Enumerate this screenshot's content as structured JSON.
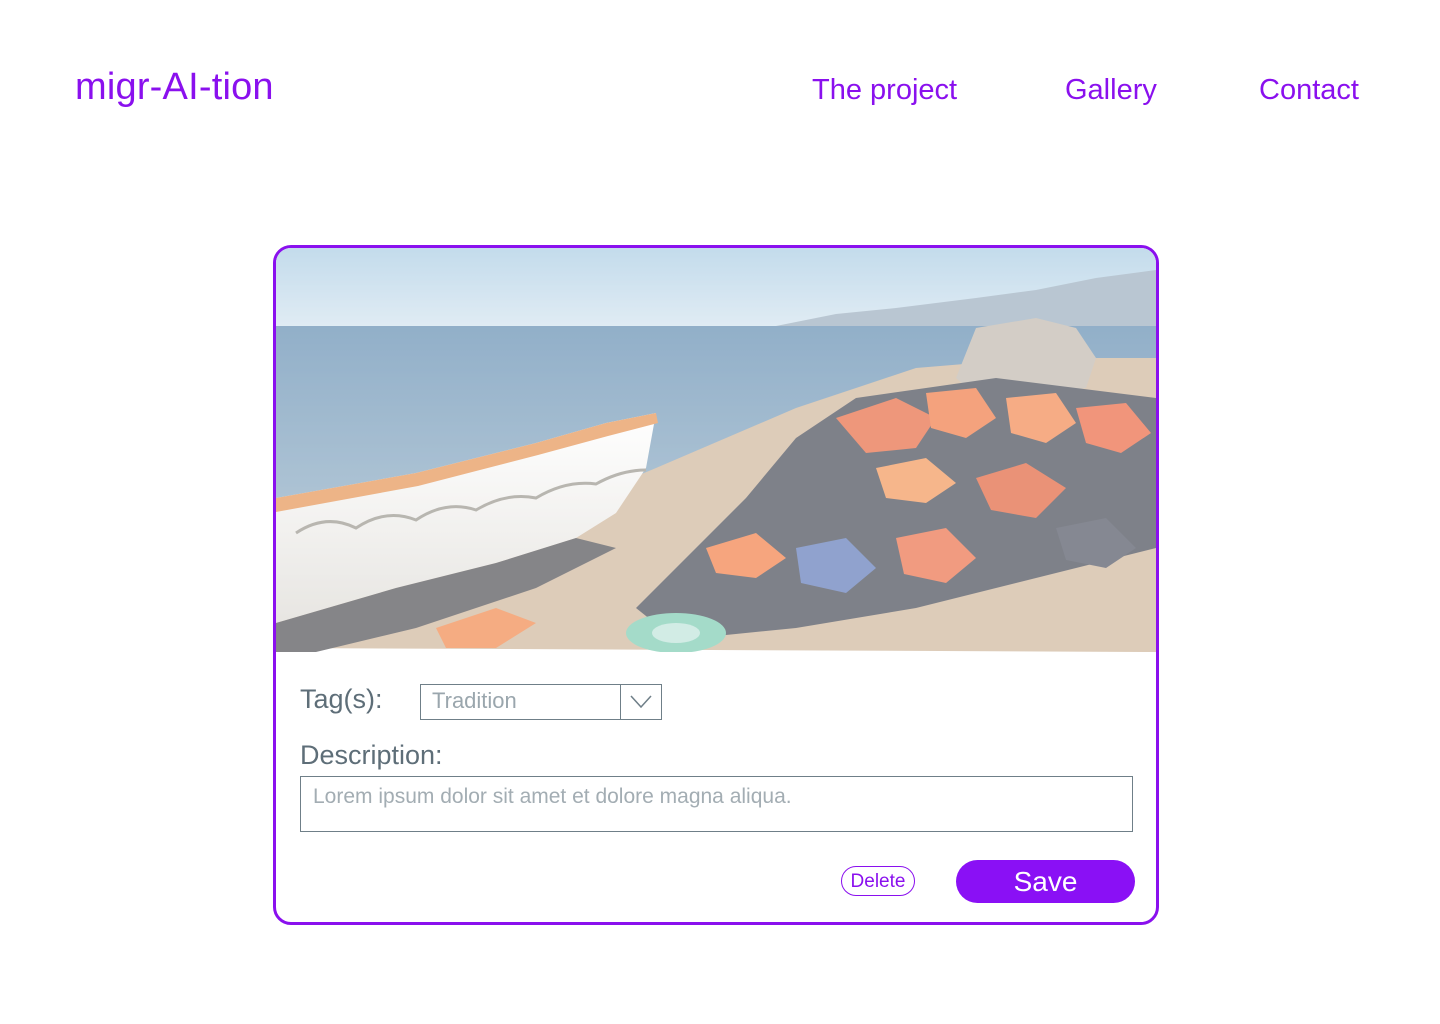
{
  "header": {
    "brand": "migr-AI-tion",
    "nav": [
      {
        "label": "The project"
      },
      {
        "label": "Gallery"
      },
      {
        "label": "Contact"
      }
    ]
  },
  "card": {
    "tags_label": "Tag(s):",
    "tags_selected": "Tradition",
    "description_label": "Description:",
    "description_placeholder": "Lorem ipsum dolor sit amet et dolore magna aliqua.",
    "delete_label": "Delete",
    "save_label": "Save"
  },
  "colors": {
    "accent": "#8a10ee",
    "label": "#5e6e78",
    "field_border": "#6f7f88"
  },
  "icons": {
    "select": "chevron-down-icon"
  }
}
